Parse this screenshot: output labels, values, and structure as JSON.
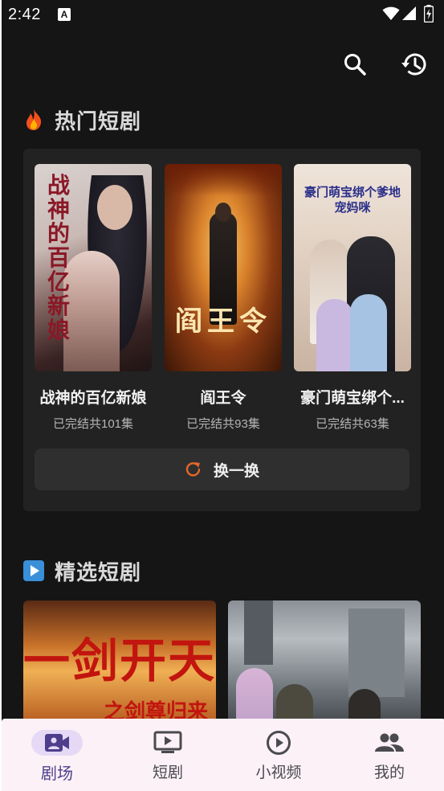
{
  "status_bar": {
    "time": "2:42",
    "notification_icon": "a-icon"
  },
  "top_actions": {
    "search_icon": "search-icon",
    "history_icon": "history-icon"
  },
  "hot_section": {
    "title": "热门短剧",
    "icon": "fire-icon",
    "dramas": [
      {
        "title": "战神的百亿新娘",
        "meta": "已完结共101集",
        "poster_text": "战神的百亿新娘"
      },
      {
        "title": "阎王令",
        "meta": "已完结共93集",
        "poster_text": "阎王令"
      },
      {
        "title": "豪门萌宝绑个...",
        "meta": "已完结共63集",
        "poster_text": "豪门萌宝绑个爹地宠妈咪"
      }
    ],
    "refresh_label": "换一换"
  },
  "featured_section": {
    "title": "精选短剧",
    "icon": "play-square-icon",
    "items": [
      {
        "poster_text": "一剑开天",
        "poster_subtext": "之剑尊归来"
      },
      {
        "poster_text": ""
      }
    ]
  },
  "bottom_nav": {
    "items": [
      {
        "label": "剧场",
        "icon": "video-camera-icon",
        "active": true
      },
      {
        "label": "短剧",
        "icon": "tv-icon",
        "active": false
      },
      {
        "label": "小视频",
        "icon": "play-circle-icon",
        "active": false
      },
      {
        "label": "我的",
        "icon": "people-icon",
        "active": false
      }
    ]
  },
  "colors": {
    "background": "#151515",
    "panel": "#222222",
    "accent_orange": "#e8662a",
    "nav_active": "#4d3f8c",
    "nav_bg": "#fbf1f7"
  }
}
